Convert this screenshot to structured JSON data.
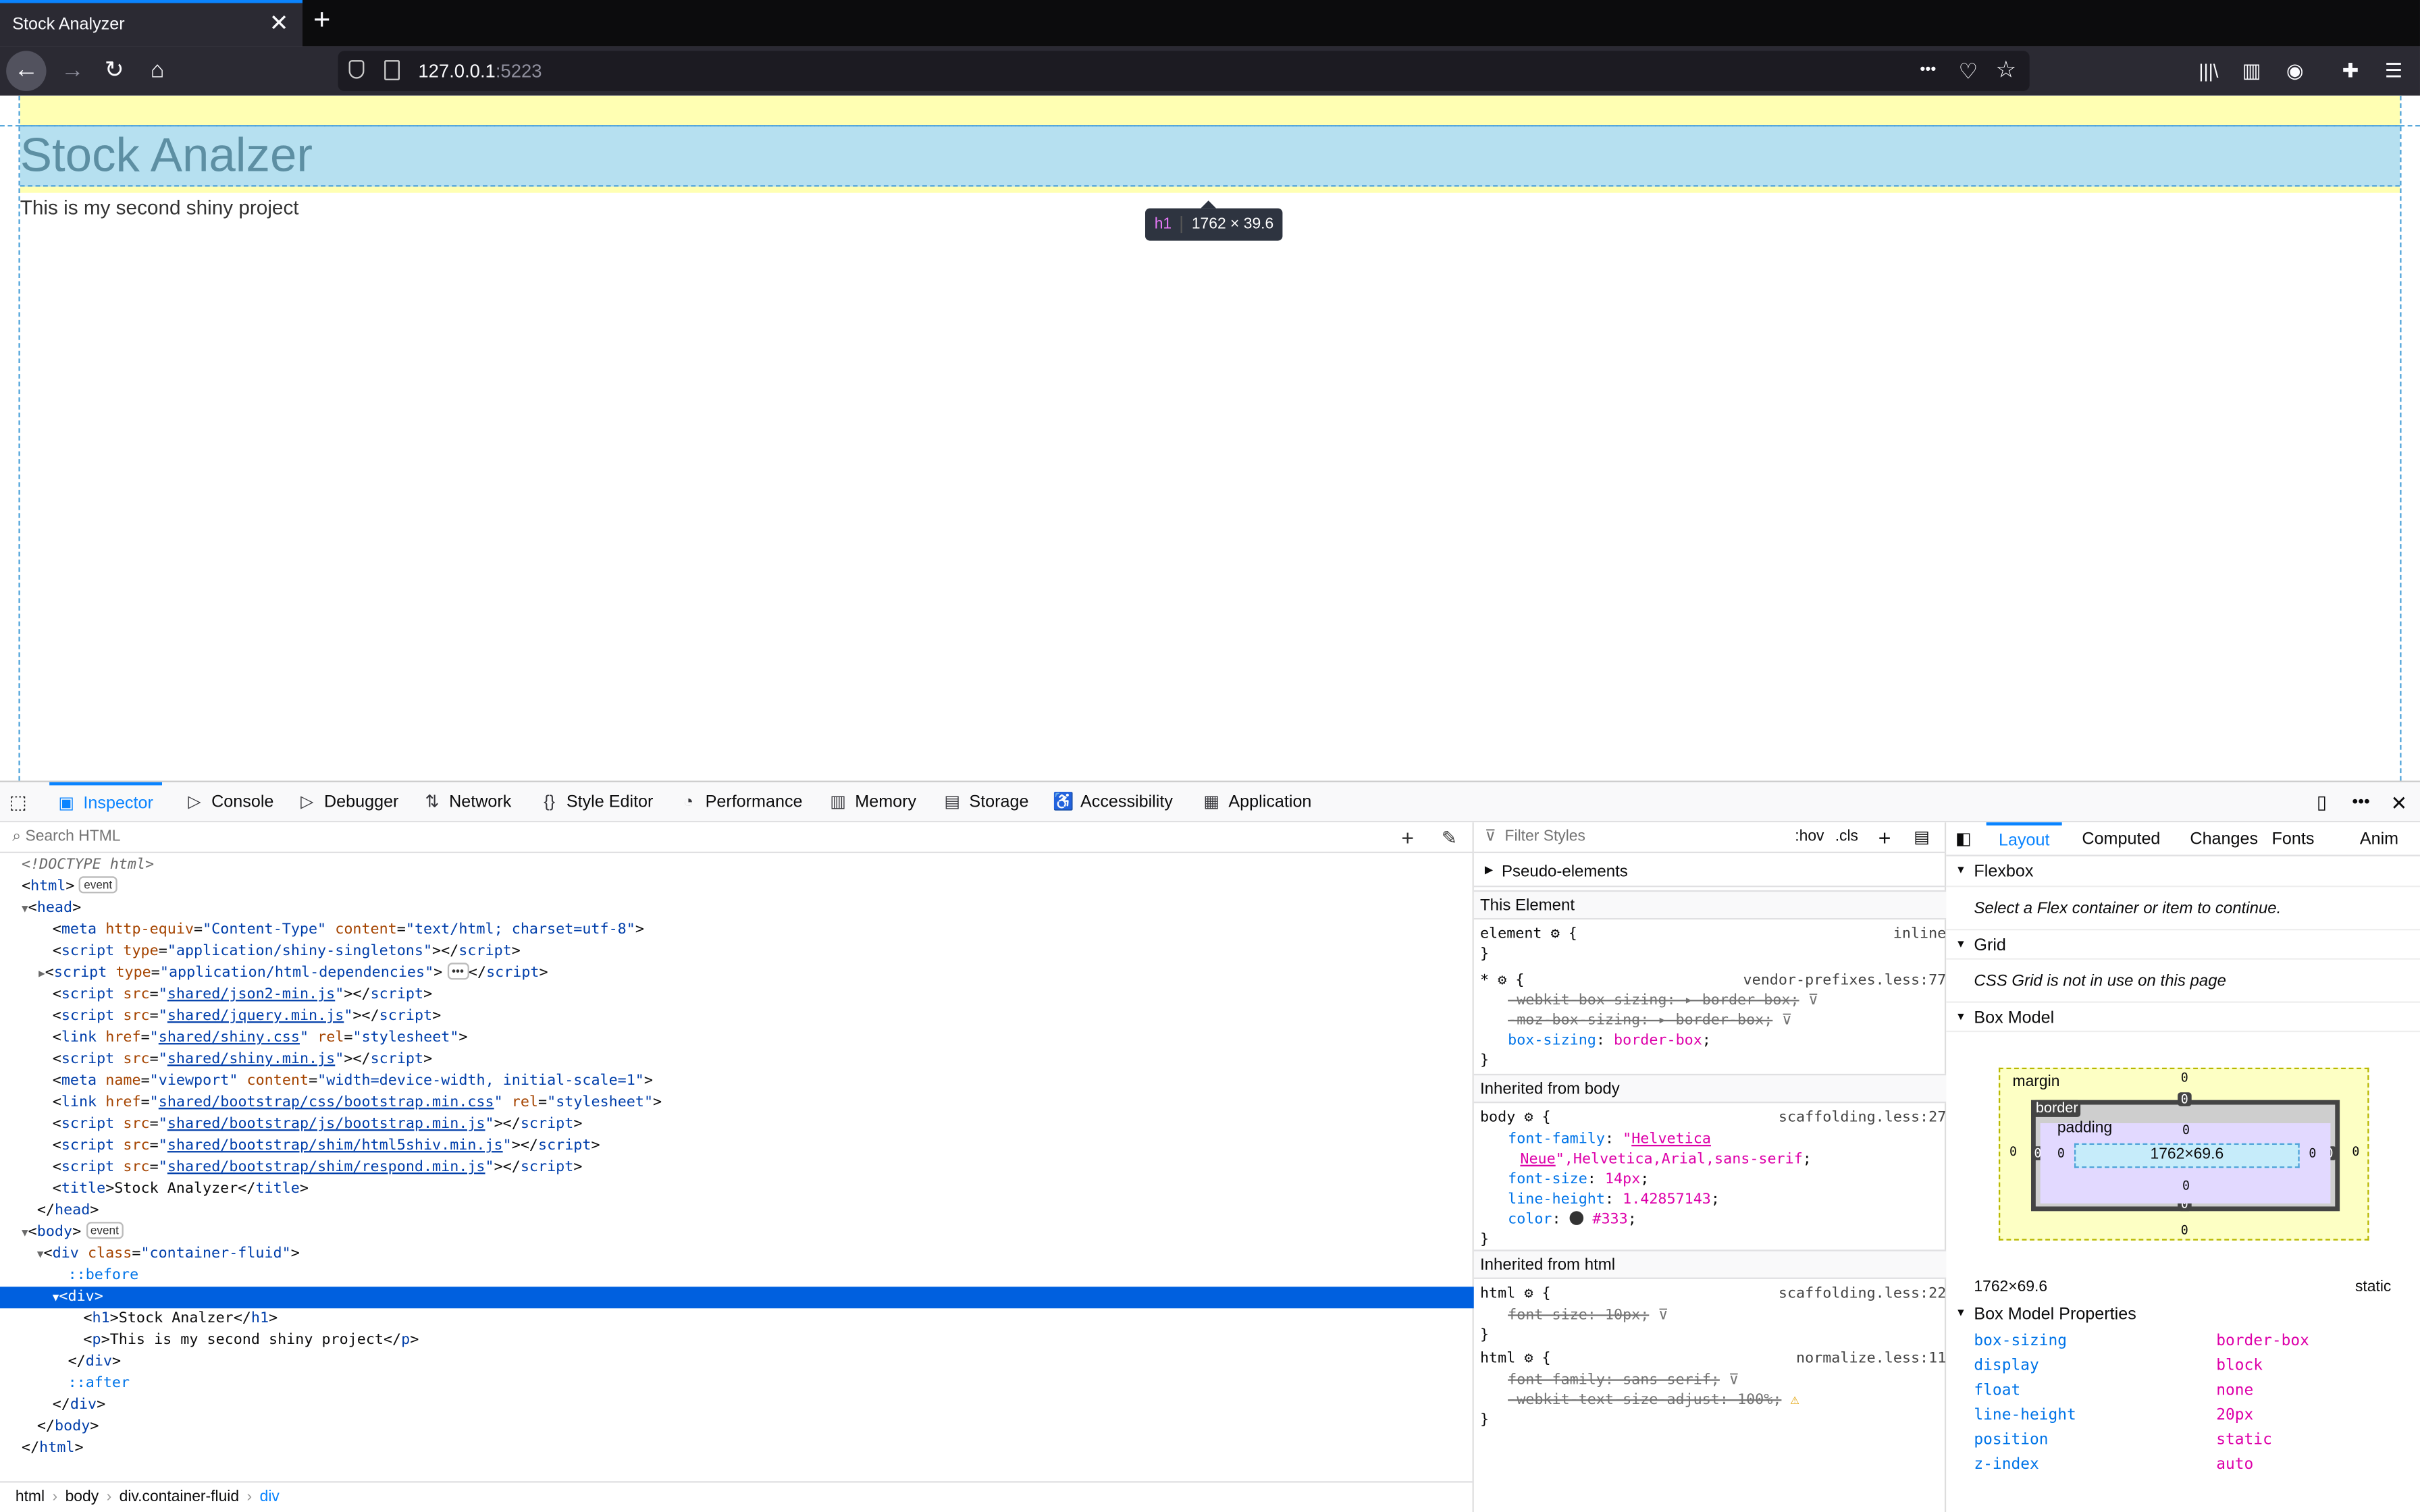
{
  "tab": {
    "title": "Stock Analyzer",
    "close": "✕",
    "new": "+"
  },
  "nav": {
    "back": "←",
    "forward": "→",
    "reload": "↻",
    "home": "⌂",
    "url_host": "127.0.0.1",
    "url_port": ":5223",
    "more": "•••",
    "pocket": "♡",
    "star": "☆",
    "library": "|||\\",
    "sidebar": "▥",
    "account": "◉",
    "extensions": "✚",
    "menu": "☰"
  },
  "page": {
    "heading": "Stock Analzer",
    "paragraph": "This is my second shiny project",
    "tooltip_tag": "h1",
    "tooltip_size": "1762 × 39.6"
  },
  "devtools": {
    "tabs": [
      "Inspector",
      "Console",
      "Debugger",
      "Network",
      "Style Editor",
      "Performance",
      "Memory",
      "Storage",
      "Accessibility",
      "Application"
    ],
    "tab_icons": [
      "▣",
      "▷",
      "▷",
      "⇅",
      "{}",
      "◔",
      "▥",
      "▤",
      "♿",
      "▦"
    ],
    "search_placeholder": "Search HTML",
    "breadcrumbs": [
      "html",
      "body",
      "div.container-fluid",
      "div"
    ]
  },
  "rules": {
    "filter_placeholder": "Filter Styles",
    "hov": ":hov",
    "cls": ".cls",
    "pseudo": "Pseudo-elements",
    "this_element": "This Element",
    "inherited_body": "Inherited from body",
    "inherited_html": "Inherited from html"
  },
  "layout": {
    "tabs": [
      "Layout",
      "Computed",
      "Changes",
      "Fonts",
      "Anim"
    ],
    "flexbox": "Flexbox",
    "flexbox_hint": "Select a Flex container or item to continue.",
    "grid": "Grid",
    "grid_hint": "CSS Grid is not in use on this page",
    "boxmodel": "Box Model",
    "margin": "margin",
    "border": "border",
    "padding": "padding",
    "content_size": "1762×69.6",
    "zero": "0",
    "size": "1762×69.6",
    "position": "static",
    "props_title": "Box Model Properties",
    "props": [
      {
        "k": "box-sizing",
        "v": "border-box"
      },
      {
        "k": "display",
        "v": "block"
      },
      {
        "k": "float",
        "v": "none"
      },
      {
        "k": "line-height",
        "v": "20px"
      },
      {
        "k": "position",
        "v": "static"
      },
      {
        "k": "z-index",
        "v": "auto"
      }
    ]
  }
}
